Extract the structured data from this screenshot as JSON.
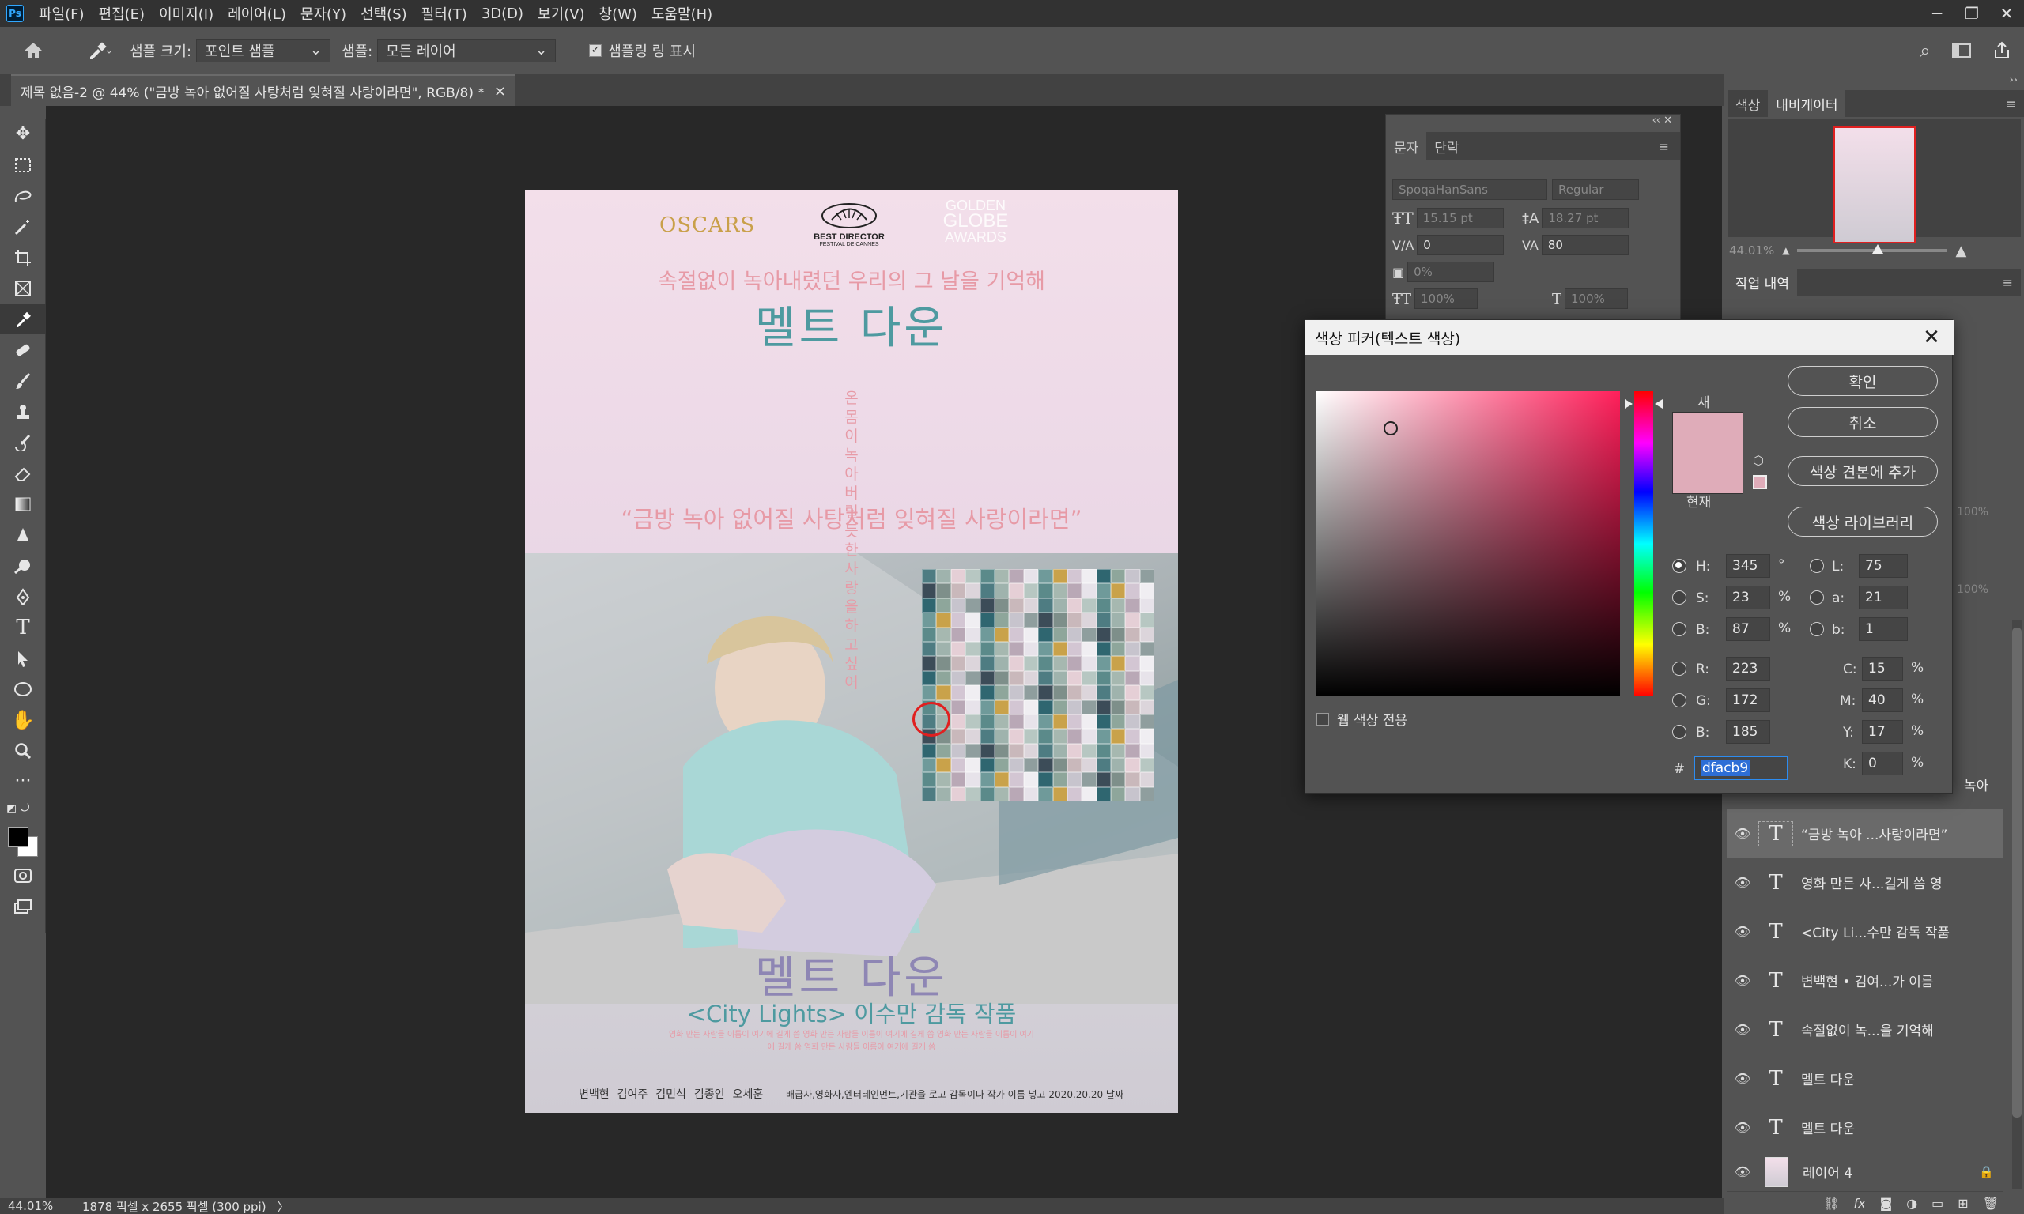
{
  "app": {
    "logo": "Ps",
    "menus": [
      "파일(F)",
      "편집(E)",
      "이미지(I)",
      "레이어(L)",
      "문자(Y)",
      "선택(S)",
      "필터(T)",
      "3D(D)",
      "보기(V)",
      "창(W)",
      "도움말(H)"
    ],
    "window_controls": [
      "─",
      "❐",
      "✕"
    ]
  },
  "options": {
    "sample_size_label": "샘플 크기:",
    "sample_size_value": "포인트 샘플",
    "sample_label": "샘플:",
    "sample_value": "모든 레이어",
    "show_ring_label": "샘플링 링 표시",
    "show_ring_checked": true
  },
  "document": {
    "tab_title": "제목 없음-2 @ 44% (\"금방 녹아 없어질 사탕처럼 잊혀질 사랑이라면\", RGB/8) *",
    "tab_close": "×"
  },
  "status": {
    "zoom": "44.01%",
    "dimensions": "1878 픽셀 x 2655 픽셀 (300 ppi)",
    "arrow": "〉"
  },
  "poster": {
    "award1": "OSCARS",
    "award2_line1": "BEST DIRECTOR",
    "award2_line2": "FESTIVAL DE CANNES",
    "award3_line1": "GOLDEN",
    "award3_line2": "GLOBE",
    "award3_line3": "AWARDS",
    "tagline": "속절없이 녹아내렸던 우리의 그 날을 기억해",
    "title_top": "멜트 다운",
    "vertical_text": "온몸이녹아버릴듯한 사랑을 하고 싶어",
    "quote": "“금방 녹아 없어질 사탕처럼 잊혀질 사랑이라면”",
    "title_bottom": "멜트 다운",
    "subtitle": "<City Lights> 이수만 감독 작품",
    "credits_small": "영화 만든 사람들 이름이 여기에 길게 씀 영화 만든 사람들 이름이 여기에 길게 씀 영화 만든 사람들 이름이 여기에 길게 씀 영화 만든 사람들 이름이 여기에 길게 씀",
    "cast": [
      "변백현",
      "김여주",
      "김민석",
      "김종인",
      "오세훈"
    ],
    "footer": "배급사,영화사,엔터테인먼트,기관을 로고 감독이나 작가 이름 넣고 2020.20.20 날짜"
  },
  "char_panel": {
    "tabs": [
      "문자",
      "단락"
    ],
    "font": "SpoqaHanSans",
    "style": "Regular",
    "size": "15.15 pt",
    "leading": "18.27 pt",
    "kerning": "0",
    "tracking": "80",
    "tsume": "0%",
    "vscale": "100%",
    "hscale": "100%"
  },
  "color_picker": {
    "title": "색상 피커(텍스트 색상)",
    "close": "✕",
    "new_label": "새",
    "current_label": "현재",
    "ok": "확인",
    "cancel": "취소",
    "add_swatch": "색상 견본에 추가",
    "libraries": "색상 라이브러리",
    "web_only": "웹 색상 전용",
    "color_hex_display": "#dfacb9",
    "H": "345",
    "S": "23",
    "Bv": "87",
    "R": "223",
    "G": "172",
    "Bc": "185",
    "L": "75",
    "a": "21",
    "b": "1",
    "C": "15",
    "M": "40",
    "Y": "17",
    "K": "0",
    "hex": "dfacb9",
    "deg": "°",
    "pct": "%",
    "hash": "#"
  },
  "right_panels": {
    "tabs": [
      "색상",
      "내비게이터"
    ],
    "nav_zoom": "44.01%",
    "history_tab": "작업 내역",
    "opacity_100": "100%",
    "fill_100": "100%"
  },
  "layers": [
    {
      "name": "녹아",
      "type": "partial"
    },
    {
      "name": "“금방 녹아 ...사랑이라면”",
      "type": "text",
      "selected": true
    },
    {
      "name": "영화 만든 사...길게 씀 영",
      "type": "text"
    },
    {
      "name": "<City Li...수만 감독 작품",
      "type": "text"
    },
    {
      "name": "변백현 • 김여...가 이름",
      "type": "text"
    },
    {
      "name": "속절없이 녹...을 기억해",
      "type": "text"
    },
    {
      "name": "멜트 다운",
      "type": "text"
    },
    {
      "name": "멜트 다운",
      "type": "text"
    },
    {
      "name": "레이어 4",
      "type": "raster"
    }
  ],
  "colors": {
    "accent_pink": "#dfacb9",
    "title_teal": "#4e9aa0",
    "title_lavender": "#8e86b4",
    "tagline_pink": "#e79aa6",
    "oscar_gold": "#c9a04a"
  }
}
